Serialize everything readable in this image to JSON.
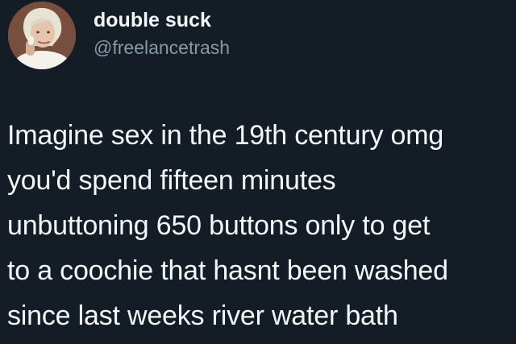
{
  "author": {
    "display_name": "double suck",
    "handle": "@freelancetrash"
  },
  "tweet": {
    "lines": [
      "Imagine sex in the 19th century omg",
      "you'd spend fifteen minutes",
      "unbuttoning 650 buttons only to get",
      "to a coochie that hasnt been washed",
      "since last weeks river water bath"
    ]
  },
  "colors": {
    "background": "#141d26",
    "text": "#f5f8fa",
    "handle": "#8899a6"
  }
}
